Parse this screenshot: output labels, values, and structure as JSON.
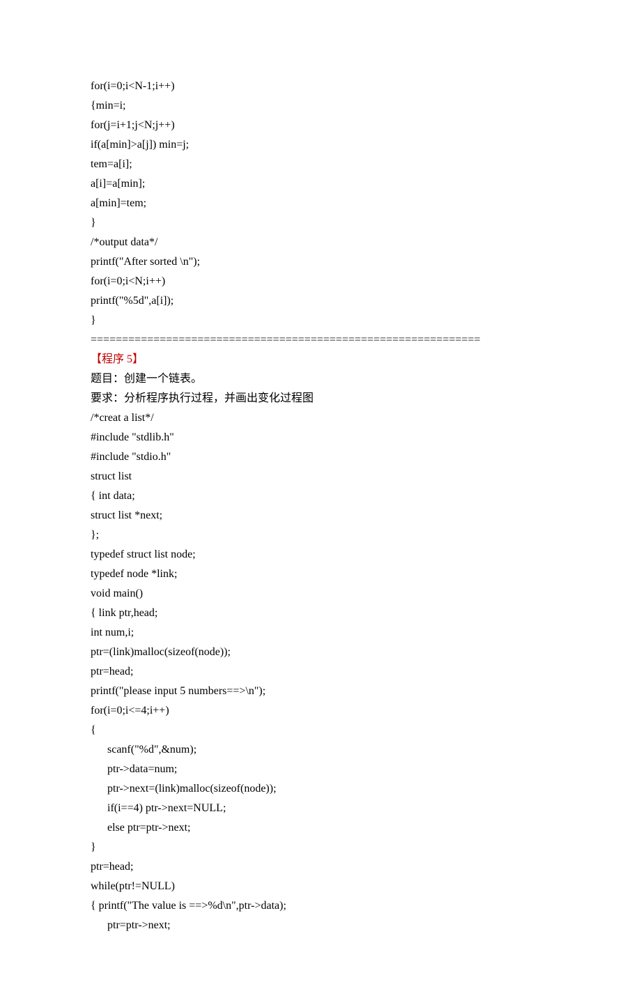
{
  "code_top": [
    "for(i=0;i<N-1;i++)",
    "{min=i;",
    "for(j=i+1;j<N;j++)",
    "if(a[min]>a[j]) min=j;",
    "tem=a[i];",
    "a[i]=a[min];",
    "a[min]=tem;",
    "}",
    "/*output data*/",
    "printf(\"After sorted \\n\");",
    "for(i=0;i<N;i++)",
    "printf(\"%5d\",a[i]);",
    "}"
  ],
  "divider": "==============================================================",
  "heading": "【程序 5】",
  "desc_title": "题目：创建一个链表。",
  "desc_req": "要求：分析程序执行过程，并画出变化过程图",
  "code_bottom_1": [
    "/*creat a list*/",
    "#include \"stdlib.h\"",
    "#include \"stdio.h\"",
    "struct list",
    "{ int data;",
    "struct list *next;",
    "};",
    "typedef struct list node;",
    "typedef node *link;",
    "void main()",
    "{ link ptr,head;",
    "int num,i;",
    "ptr=(link)malloc(sizeof(node));",
    "ptr=head;",
    "printf(\"please input 5 numbers==>\\n\");",
    "for(i=0;i<=4;i++)",
    "{"
  ],
  "code_bottom_indent": [
    "scanf(\"%d\",&num);",
    "ptr->data=num;",
    "ptr->next=(link)malloc(sizeof(node));",
    "if(i==4) ptr->next=NULL;",
    "else ptr=ptr->next;"
  ],
  "code_bottom_2": [
    "}",
    "ptr=head;",
    "while(ptr!=NULL)",
    "{ printf(\"The value is ==>%d\\n\",ptr->data);"
  ],
  "code_bottom_indent2": [
    "ptr=ptr->next;"
  ]
}
